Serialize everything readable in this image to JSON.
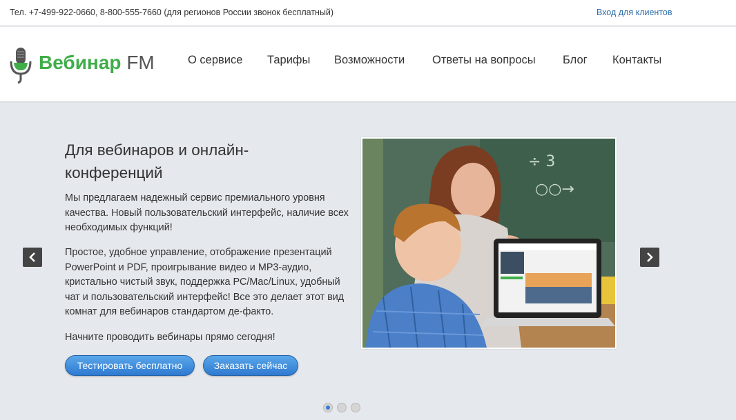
{
  "topbar": {
    "phone_text": "Тел. +7-499-922-0660, 8-800-555-7660 (для регионов России звонок бесплатный)",
    "login_label": "Вход для клиентов"
  },
  "brand": {
    "name": "Вебинар",
    "suffix": "FM",
    "mic_icon": "microphone-icon",
    "green": "#3fae49"
  },
  "nav": {
    "items": [
      {
        "label": "О сервисе"
      },
      {
        "label": "Тарифы"
      },
      {
        "label": "Возможности"
      },
      {
        "label": "Ответы на вопросы"
      },
      {
        "label": "Блог"
      },
      {
        "label": "Контакты"
      }
    ]
  },
  "hero": {
    "title": "Для вебинаров и онлайн-конференций",
    "paragraph1": "Мы предлагаем надежный сервис премиального уровня качества. Новый пользовательский интерфейс, наличие всех необходимых функций!",
    "paragraph2": "Простое, удобное управление, отображение презентаций PowerPoint и PDF, проигрывание видео и MP3-аудио, кристально чистый звук, поддержка PC/Mac/Linux, удобный чат и пользовательский интерфейс! Все это делает этот вид комнат для вебинаров стандартом де-факто.",
    "paragraph3": "Начните проводить вебинары прямо сегодня!",
    "btn_try": "Тестировать бесплатно",
    "btn_order": "Заказать сейчас",
    "prev_icon": "chevron-left-icon",
    "next_icon": "chevron-right-icon"
  },
  "carousel": {
    "slides": 3,
    "active_index": 0
  },
  "colors": {
    "button_blue": "#2f7ad1",
    "link_blue": "#2a6ca8",
    "hero_bg": "#e5e8ec"
  }
}
